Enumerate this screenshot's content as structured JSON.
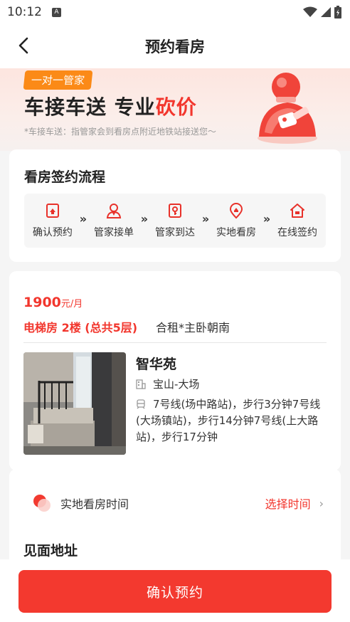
{
  "status_bar": {
    "time": "10:12",
    "notif_letter": "A"
  },
  "nav": {
    "title": "预约看房"
  },
  "banner": {
    "tag": "一对一管家",
    "headline_main": "车接车送 专业",
    "headline_highlight": "砍价",
    "subtitle": "*车接车送：指管家会到看房点附近地铁站接送您～"
  },
  "flow": {
    "title": "看房签约流程",
    "steps": [
      {
        "label": "确认预约",
        "icon": "calendar-icon"
      },
      {
        "label": "管家接单",
        "icon": "agent-icon"
      },
      {
        "label": "管家到达",
        "icon": "key-icon"
      },
      {
        "label": "实地看房",
        "icon": "location-pin-icon"
      },
      {
        "label": "在线签约",
        "icon": "house-icon"
      }
    ],
    "separator": "»"
  },
  "house": {
    "price": "1900",
    "price_unit": "元/月",
    "floor": "电梯房 2楼 (总共5层)",
    "rent_type": "合租*主卧朝南",
    "name": "智华苑",
    "district": "宝山-大场",
    "metro": "7号线(场中路站)，步行3分钟7号线(大场镇站)，步行14分钟7号线(上大路站)，步行17分钟"
  },
  "visit": {
    "time_label": "实地看房时间",
    "time_action": "选择时间",
    "address_title": "见面地址"
  },
  "footer": {
    "confirm_label": "确认预约"
  },
  "colors": {
    "accent": "#f2362d",
    "tag_orange": "#fb8a17"
  }
}
